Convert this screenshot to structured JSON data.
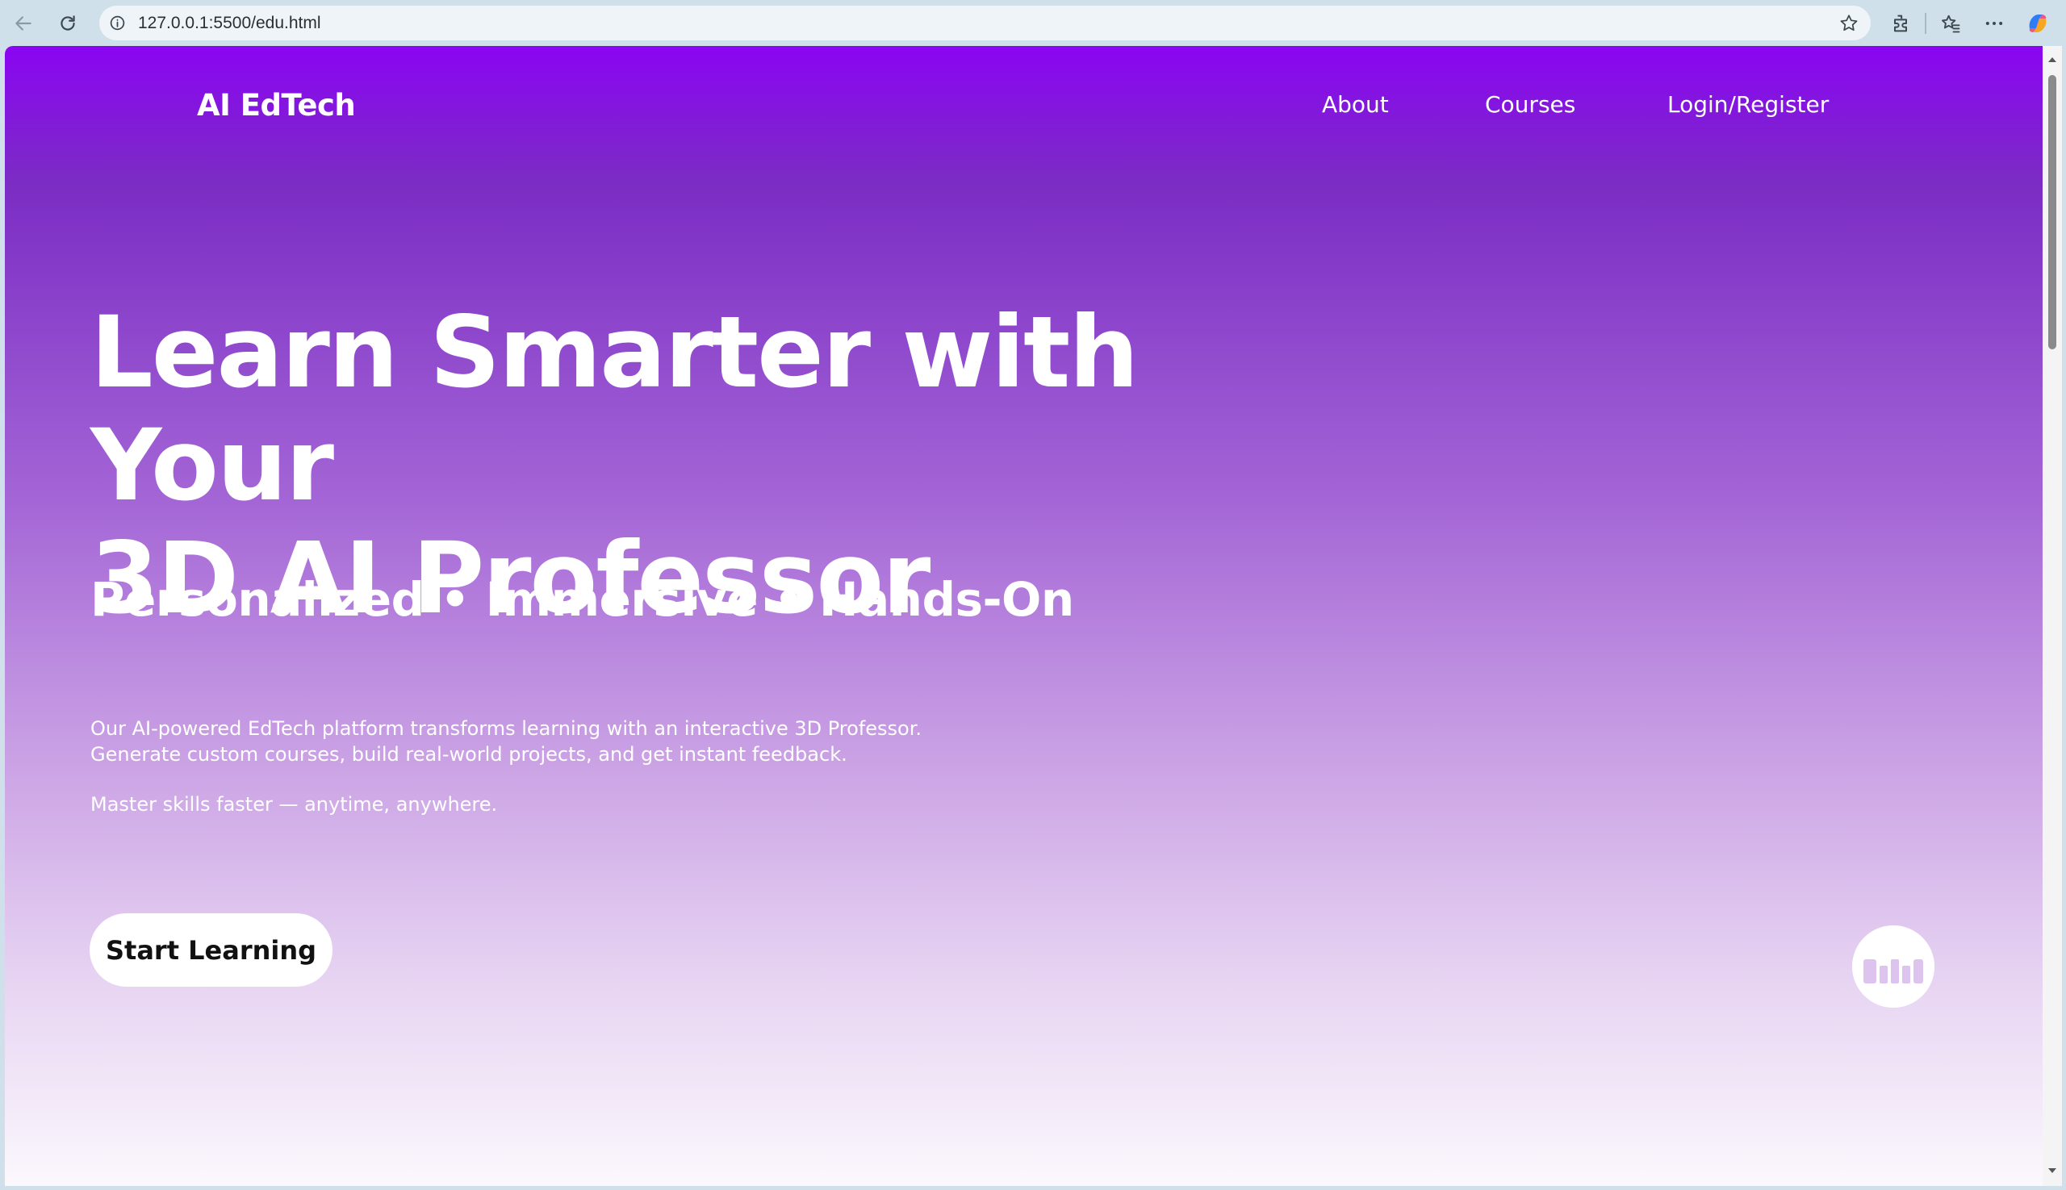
{
  "browser": {
    "url": "127.0.0.1:5500/edu.html",
    "icons": [
      "back-arrow-icon",
      "refresh-icon",
      "info-icon",
      "star-icon",
      "extensions-icon",
      "favorites-icon",
      "more-icon",
      "copilot-icon"
    ]
  },
  "header": {
    "brand": "AI EdTech",
    "nav": {
      "about": "About",
      "courses": "Courses",
      "login": "Login/Register"
    }
  },
  "hero": {
    "title_line1": "Learn Smarter with Your",
    "title_line2": "3D AI Professor",
    "subtitle": "Personalized • Immersive • Hands-On",
    "desc_line1": "Our AI-powered EdTech platform transforms learning with an interactive 3D Professor.",
    "desc_line2": "Generate custom courses, build real-world projects, and get instant feedback.",
    "desc_line3": "Master skills faster — anytime, anywhere.",
    "cta": "Start Learning"
  },
  "colors": {
    "gradient_top": "#8a05f2",
    "gradient_bottom": "#fbf8fd",
    "text": "#ffffff"
  }
}
